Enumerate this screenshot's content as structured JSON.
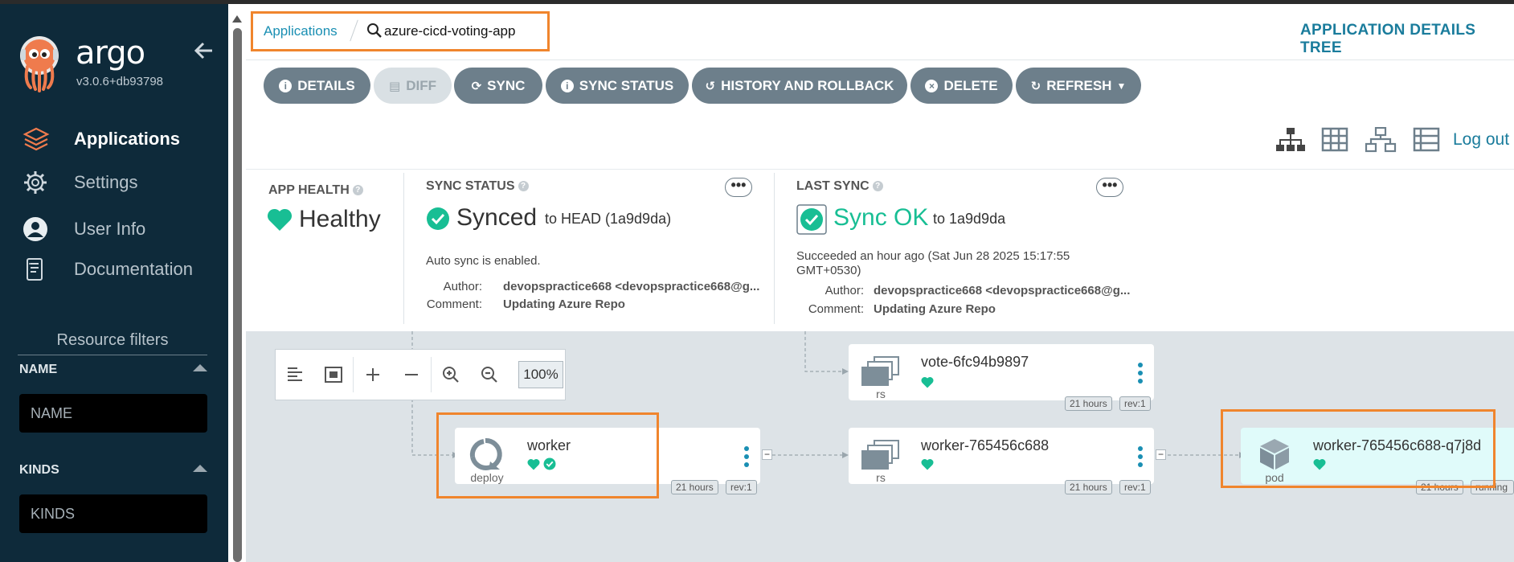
{
  "brand": {
    "name": "argo",
    "version": "v3.0.6+db93798"
  },
  "sidebar": {
    "items": [
      {
        "label": "Applications",
        "icon": "layers-icon",
        "active": true
      },
      {
        "label": "Settings",
        "icon": "gear-icon",
        "active": false
      },
      {
        "label": "User Info",
        "icon": "user-icon",
        "active": false
      },
      {
        "label": "Documentation",
        "icon": "documentation-icon",
        "active": false
      }
    ],
    "filters_title": "Resource filters",
    "name_filter": {
      "label": "NAME",
      "placeholder": "NAME"
    },
    "kinds_filter": {
      "label": "KINDS",
      "placeholder": "KINDS"
    }
  },
  "header": {
    "breadcrumb_apps": "Applications",
    "breadcrumb_app": "azure-cicd-voting-app",
    "page_title": "APPLICATION DETAILS TREE"
  },
  "toolbar": {
    "details": "DETAILS",
    "diff": "DIFF",
    "sync": "SYNC",
    "sync_status": "SYNC STATUS",
    "history": "HISTORY AND ROLLBACK",
    "delete": "DELETE",
    "refresh": "REFRESH"
  },
  "logout": "Log out",
  "app_health": {
    "label": "APP HEALTH",
    "value": "Healthy"
  },
  "sync_status": {
    "label": "SYNC STATUS",
    "value": "Synced",
    "target": "to HEAD (1a9d9da)",
    "auto_sync": "Auto sync is enabled.",
    "author_key": "Author:",
    "author": "devopspractice668 <devopspractice668@g...",
    "comment_key": "Comment:",
    "comment": "Updating Azure Repo"
  },
  "last_sync": {
    "label": "LAST SYNC",
    "value": "Sync OK",
    "target": "to 1a9d9da",
    "succeeded_line1": "Succeeded an hour ago (Sat Jun 28 2025 15:17:55",
    "succeeded_line2": "GMT+0530)",
    "author_key": "Author:",
    "author": "devopspractice668 <devopspractice668@g...",
    "comment_key": "Comment:",
    "comment": "Updating Azure Repo"
  },
  "graph": {
    "zoom_level": "100%",
    "nodes": {
      "vote_rs": {
        "name": "vote-6fc94b9897",
        "kind": "rs",
        "age": "21 hours",
        "rev": "rev:1"
      },
      "worker_deploy": {
        "name": "worker",
        "kind": "deploy",
        "age": "21 hours",
        "rev": "rev:1"
      },
      "worker_rs": {
        "name": "worker-765456c688",
        "kind": "rs",
        "age": "21 hours",
        "rev": "rev:1"
      },
      "worker_pod": {
        "name": "worker-765456c688-q7j8d",
        "kind": "pod",
        "age": "21 hours",
        "status": "running"
      }
    }
  },
  "colors": {
    "sidebar_bg": "#0e2a3a",
    "accent": "#1a7c9c",
    "healthy": "#18be94",
    "highlight": "#f0852d",
    "button": "#6d7f8b"
  }
}
